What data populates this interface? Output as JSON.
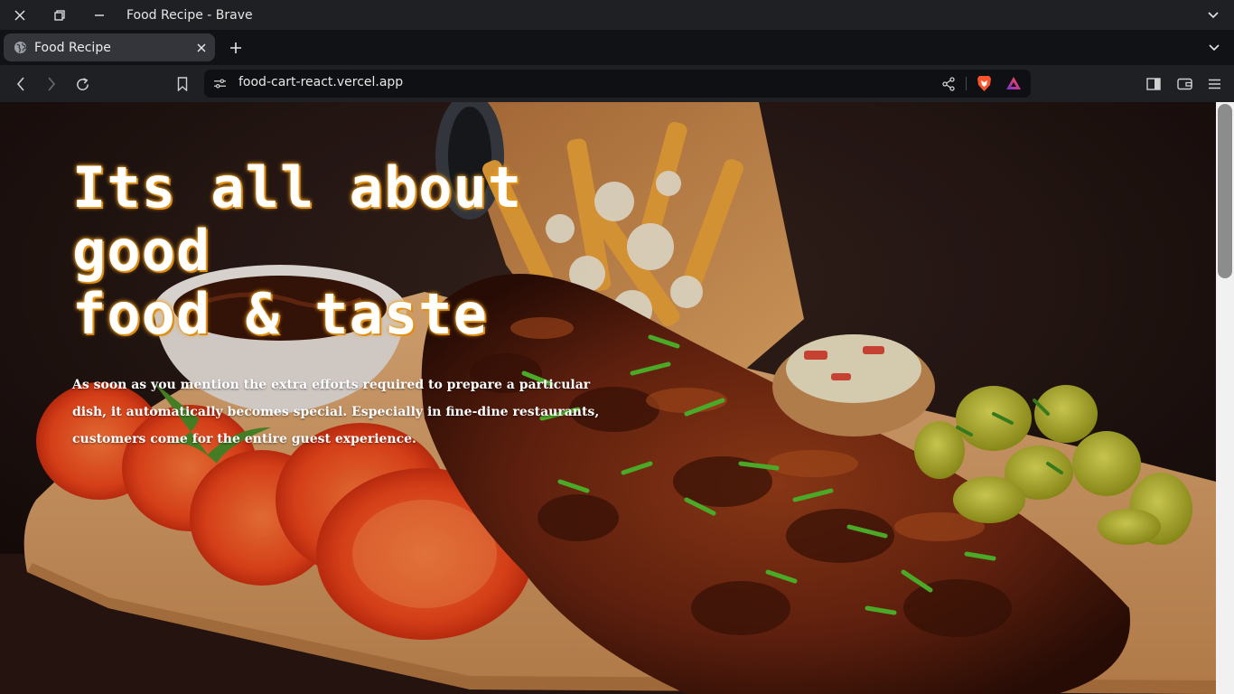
{
  "window": {
    "title": "Food Recipe - Brave"
  },
  "tabs": [
    {
      "label": "Food Recipe",
      "active": true
    }
  ],
  "toolbar": {
    "url": "food-cart-react.vercel.app"
  },
  "hero": {
    "heading_line1": "Its all about good",
    "heading_line2": "food & taste",
    "paragraph": "As soon as you mention the extra efforts required to prepare a particular dish, it automatically becomes special. Especially in fine-dine restaurants, customers come for the entire guest experience."
  },
  "colors": {
    "heading_glow": "#f0a020",
    "tab_active_bg": "#33353b",
    "toolbar_bg": "#1f2024",
    "brave_orange": "#fb542b"
  },
  "icons": {
    "close": "close-icon",
    "restore": "restore-icon",
    "minimize": "minimize-icon",
    "back": "back-arrow-icon",
    "forward": "forward-arrow-icon",
    "reload": "reload-icon",
    "bookmark": "bookmark-icon",
    "site_info": "site-settings-icon",
    "share": "share-icon",
    "brave_shield": "brave-shield-icon",
    "rewards": "brave-rewards-icon",
    "sidebar": "sidebar-icon",
    "wallet": "wallet-icon",
    "menu": "hamburger-menu-icon"
  }
}
